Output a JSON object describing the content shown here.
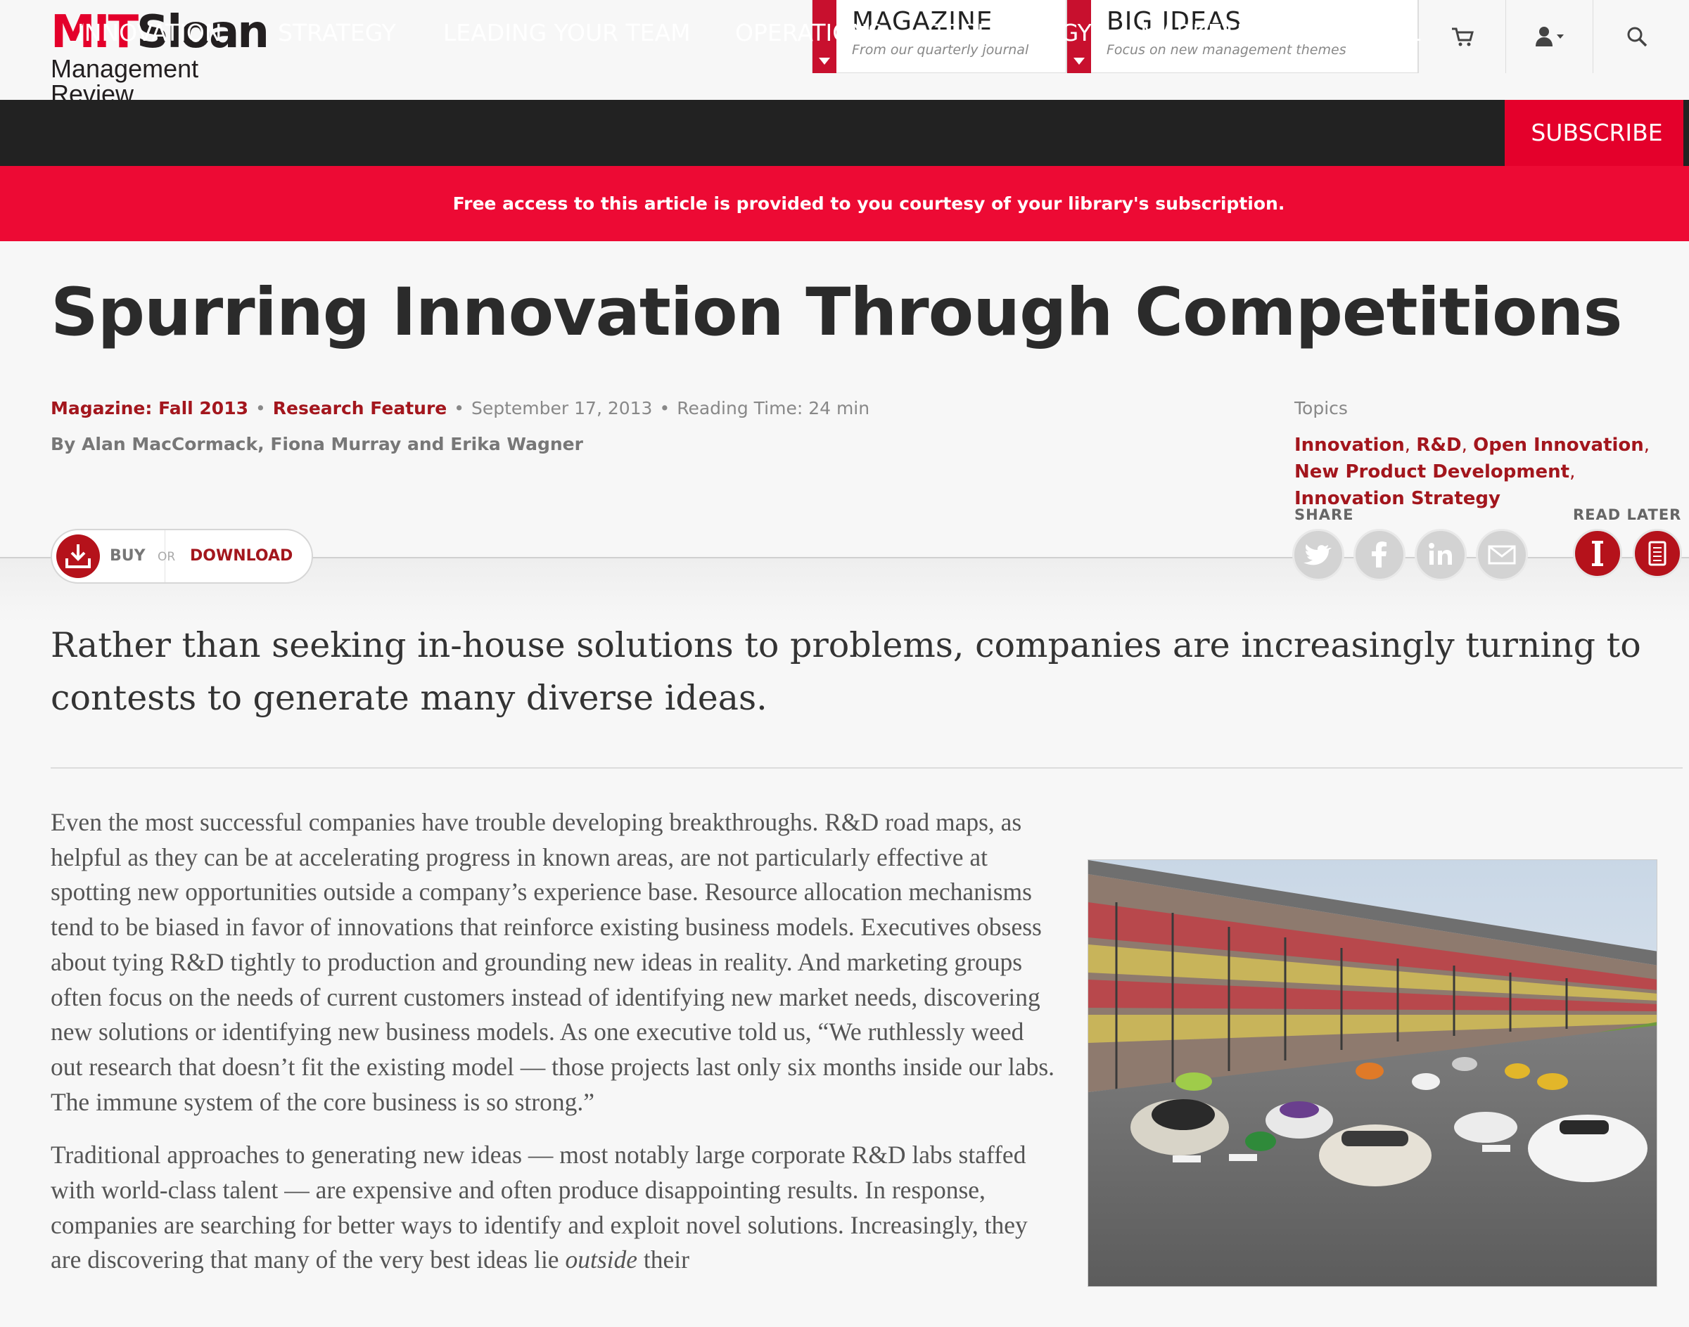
{
  "brand": {
    "logo_top_mit": "MIT",
    "logo_top_sloan": "Sloan",
    "logo_sub": "Management Review",
    "accent": "#e4002b",
    "dark": "#222222",
    "link_red": "#a3161d"
  },
  "header": {
    "magazine": {
      "title": "MAGAZINE",
      "subtitle": "From our quarterly journal"
    },
    "big_ideas": {
      "title": "BIG IDEAS",
      "subtitle": "Focus on new management themes"
    },
    "icons": [
      "cart-icon",
      "user-icon",
      "search-icon"
    ]
  },
  "nav": {
    "items": [
      "INNOVATION",
      "STRATEGY",
      "LEADING YOUR TEAM",
      "OPERATIONS",
      "TECHNOLOGY",
      "MARKETING",
      "GLOBAL"
    ],
    "subscribe": "SUBSCRIBE"
  },
  "banner": {
    "text": "Free access to this article is provided to you courtesy of your library's subscription."
  },
  "article": {
    "title": "Spurring Innovation Through Competitions",
    "magazine": "Magazine: Fall 2013",
    "feature": "Research Feature",
    "date": "September 17, 2013",
    "reading_time": "Reading Time: 24 min",
    "byline": "By Alan MacCormack, Fiona Murray and Erika Wagner",
    "topics_label": "Topics",
    "topics": [
      "Innovation",
      "R&D",
      "Open Innovation",
      "New Product Development",
      "Innovation Strategy"
    ],
    "share_label": "SHARE",
    "read_later_label": "READ LATER",
    "share_icons": [
      "twitter-icon",
      "facebook-icon",
      "linkedin-icon",
      "email-icon"
    ],
    "read_later_icons": [
      "instapaper-icon",
      "pocket-icon"
    ],
    "buy": "BUY",
    "or": "OR",
    "download": "DOWNLOAD",
    "dek": "Rather than seeking in-house solutions to problems, companies are increasingly turning to contests to generate many diverse ideas.",
    "paragraph1": "Even the most successful companies have trouble developing breakthroughs. R&D road maps, as helpful as they can be at accelerating progress in known areas, are not particularly effective at spotting new opportunities outside a company’s experience base. Resource allocation mechanisms tend to be biased in favor of innovations that reinforce existing business models. Executives obsess about tying R&D tightly to production and grounding new ideas in reality. And marketing groups often focus on the needs of current customers instead of identifying new market needs, discovering new solutions or identifying new business models. As one executive told us, “We ruthlessly weed out research that doesn’t fit the existing model — those projects last only six months inside our labs. The immune system of the core business is so strong.”",
    "paragraph2_before": "Traditional approaches to generating new ideas — most notably large corporate R&D labs staffed with world-class talent — are expensive and often produce disappointing results. In response, companies are searching for better ways to identify and exploit novel solutions. Increasingly, they are discovering that many of the very best ideas lie ",
    "paragraph2_em": "outside",
    "paragraph2_after": " their"
  }
}
